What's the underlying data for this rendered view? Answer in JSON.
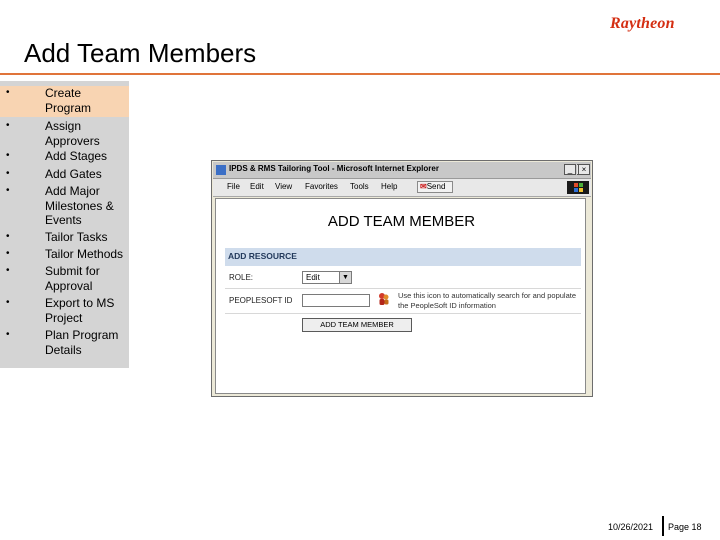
{
  "brand": {
    "logo_text": "Raytheon",
    "logo_color": "#d42e12"
  },
  "slide": {
    "title": "Add Team Members"
  },
  "agenda": {
    "items": [
      {
        "bullet": "•",
        "label": "Create Program",
        "active": true
      },
      {
        "bullet": "•",
        "label": "Assign Approvers"
      },
      {
        "bullet": "•",
        "label": "Add Stages"
      },
      {
        "bullet": "•",
        "label": "Add Gates"
      },
      {
        "bullet": "•",
        "label": "Add Major Milestones & Events"
      },
      {
        "bullet": "•",
        "label": "Tailor Tasks"
      },
      {
        "bullet": "•",
        "label": "Tailor Methods"
      },
      {
        "bullet": "•",
        "label": "Submit for Approval"
      },
      {
        "bullet": "•",
        "label": "Export to MS Project"
      },
      {
        "bullet": "•",
        "label": "Plan Program Details"
      }
    ]
  },
  "browser": {
    "window_title": "IPDS & RMS Tailoring Tool - Microsoft Internet Explorer",
    "minimize": "_",
    "maximize": "□",
    "close": "×",
    "menu": [
      "File",
      "Edit",
      "View",
      "Favorites",
      "Tools",
      "Help"
    ],
    "send_label": "Send",
    "page": {
      "heading": "ADD TEAM MEMBER",
      "section_title": "ADD RESOURCE",
      "role_label": "ROLE:",
      "role_value": "Edit",
      "dropdown_arrow": "▼",
      "people_label": "PEOPLESOFT ID",
      "people_value": "",
      "help_text": "Use this icon to automatically search for and populate the PeopleSoft ID information",
      "add_button": "ADD TEAM MEMBER"
    }
  },
  "footer": {
    "date": "10/26/2021",
    "page": "Page 18"
  }
}
